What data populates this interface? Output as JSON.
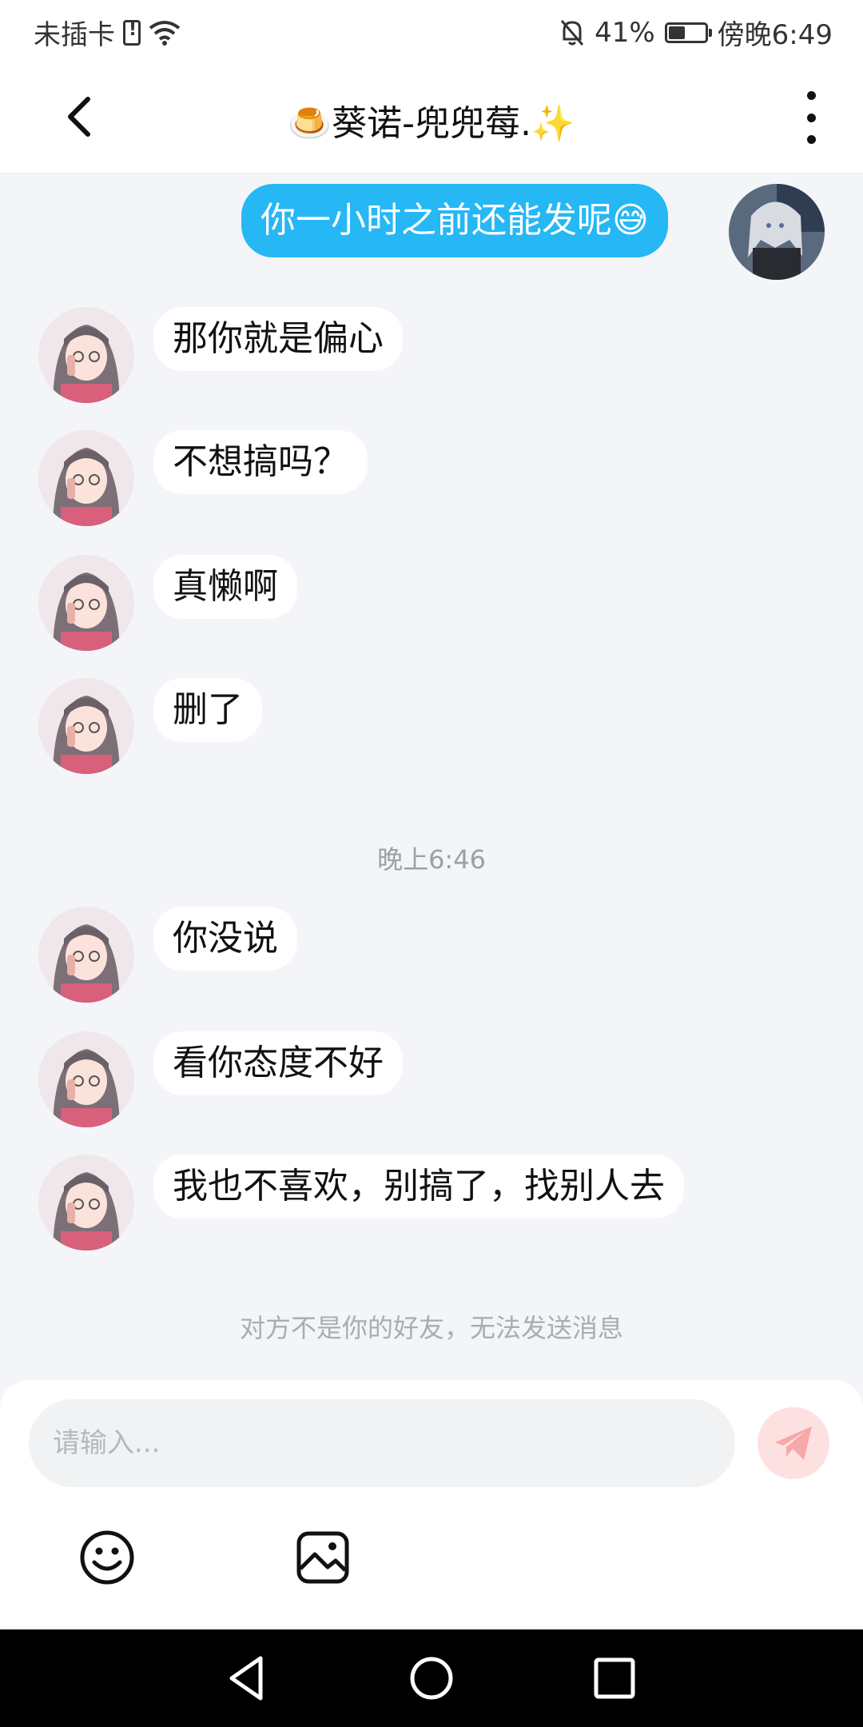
{
  "status_bar": {
    "carrier": "未插卡",
    "battery_percent": "41%",
    "time": "傍晚6:49"
  },
  "header": {
    "title": "🍮葵诺-兜兜莓.✨"
  },
  "messages": [
    {
      "side": "out",
      "text": "你一小时之前还能发呢😅"
    },
    {
      "side": "in",
      "text": "那你就是偏心"
    },
    {
      "side": "in",
      "text": "不想搞吗？"
    },
    {
      "side": "in",
      "text": "真懒啊"
    },
    {
      "side": "in",
      "text": "删了"
    },
    {
      "side": "in",
      "text": "你没说"
    },
    {
      "side": "in",
      "text": "看你态度不好"
    },
    {
      "side": "in",
      "text": "我也不喜欢，别搞了，找别人去"
    }
  ],
  "time_separator": "晚上6:46",
  "notice": "对方不是你的好友，无法发送消息",
  "input": {
    "placeholder": "请输入..."
  },
  "colors": {
    "outgoing_bubble": "#26b7f5",
    "incoming_bubble": "#ffffff",
    "background": "#f3f5f8",
    "send_button": "#fde1e1",
    "send_icon": "#f7a8a8"
  },
  "icons": [
    "back-arrow-icon",
    "more-vertical-icon",
    "emoji-icon",
    "image-icon",
    "send-icon",
    "nav-back-icon",
    "nav-home-icon",
    "nav-recents-icon"
  ]
}
